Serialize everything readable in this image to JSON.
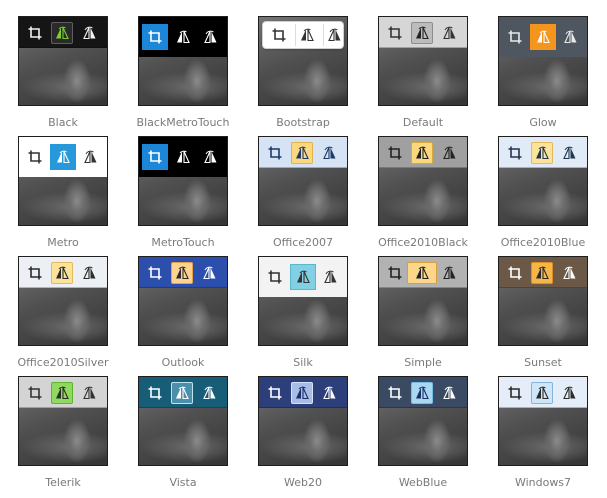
{
  "skins": [
    {
      "label": "Black",
      "tb_bg": "#151515",
      "icon": "#f2f2f2",
      "active_bg": "#2a2a2a",
      "active_border": "#5e5e5e",
      "active_icon": "#7ccf2e",
      "style": "normal"
    },
    {
      "label": "BlackMetroTouch",
      "tb_bg": "#000000",
      "icon": "#ffffff",
      "active_bg": "#1c86d8",
      "active_border": "#1c86d8",
      "active_icon": "#ffffff",
      "style": "tall-first"
    },
    {
      "label": "Bootstrap",
      "tb_bg": "#ffffff",
      "icon": "#333333",
      "active_bg": "#ffffff",
      "active_border": "#cccccc",
      "active_icon": "#333333",
      "style": "frame"
    },
    {
      "label": "Default",
      "tb_bg": "#d6d6d6",
      "icon": "#333333",
      "active_bg": "#bcbcbc",
      "active_border": "#8e8e8e",
      "active_icon": "#222222",
      "style": "normal"
    },
    {
      "label": "Glow",
      "tb_bg": "#4e5660",
      "icon": "#e8e8e8",
      "active_bg": "#f4951d",
      "active_border": "#f4951d",
      "active_icon": "#ffffff",
      "style": "tall-second"
    },
    {
      "label": "Metro",
      "tb_bg": "#ffffff",
      "icon": "#333333",
      "active_bg": "#2799db",
      "active_border": "#2799db",
      "active_icon": "#ffffff",
      "style": "tall-second"
    },
    {
      "label": "MetroTouch",
      "tb_bg": "#000000",
      "icon": "#ffffff",
      "active_bg": "#1c86d8",
      "active_border": "#1c86d8",
      "active_icon": "#ffffff",
      "style": "tall-first"
    },
    {
      "label": "Office2007",
      "tb_bg": "#d5e3f4",
      "icon": "#1f3a68",
      "active_bg": "#fbd77d",
      "active_border": "#e0b44a",
      "active_icon": "#1f3a68",
      "style": "normal"
    },
    {
      "label": "Office2010Black",
      "tb_bg": "#a0a0a0",
      "icon": "#222222",
      "active_bg": "#fbd77d",
      "active_border": "#d7a93e",
      "active_icon": "#222222",
      "style": "normal"
    },
    {
      "label": "Office2010Blue",
      "tb_bg": "#e0ebf7",
      "icon": "#22364f",
      "active_bg": "#fbe39a",
      "active_border": "#e2bb5a",
      "active_icon": "#22364f",
      "style": "normal"
    },
    {
      "label": "Office2010Silver",
      "tb_bg": "#eceff3",
      "icon": "#2b2b2b",
      "active_bg": "#fbe39a",
      "active_border": "#e2bb5a",
      "active_icon": "#2b2b2b",
      "style": "normal"
    },
    {
      "label": "Outlook",
      "tb_bg": "#2c4fae",
      "icon": "#ffffff",
      "active_bg": "#ffd38f",
      "active_border": "#e2a24c",
      "active_icon": "#2b2b2b",
      "style": "normal"
    },
    {
      "label": "Silk",
      "tb_bg": "#f3f3f3",
      "icon": "#333333",
      "active_bg": "#83d0e4",
      "active_border": "#5bb6d0",
      "active_icon": "#333333",
      "style": "tall-second"
    },
    {
      "label": "Simple",
      "tb_bg": "#b2b2b2",
      "icon": "#222222",
      "active_bg": "#fcd78a",
      "active_border": "#d79f3d",
      "active_icon": "#222222",
      "style": "normal-wide"
    },
    {
      "label": "Sunset",
      "tb_bg": "#6b5846",
      "icon": "#ffffff",
      "active_bg": "#f6b647",
      "active_border": "#dc8f1e",
      "active_icon": "#2b2b2b",
      "style": "normal"
    },
    {
      "label": "Telerik",
      "tb_bg": "#d4d4d4",
      "icon": "#333333",
      "active_bg": "#8fda5e",
      "active_border": "#5fb32e",
      "active_icon": "#2b2b2b",
      "style": "normal"
    },
    {
      "label": "Vista",
      "tb_bg": "#185d78",
      "icon": "#ffffff",
      "active_bg": "#4c8fab",
      "active_border": "#bfe3f1",
      "active_icon": "#ffffff",
      "style": "normal"
    },
    {
      "label": "Web20",
      "tb_bg": "#2d3f7b",
      "icon": "#ffffff",
      "active_bg": "#a8bce5",
      "active_border": "#d7e2f6",
      "active_icon": "#1c2f66",
      "style": "normal"
    },
    {
      "label": "WebBlue",
      "tb_bg": "#394a62",
      "icon": "#ffffff",
      "active_bg": "#a7d7f1",
      "active_border": "#78bde2",
      "active_icon": "#1c2f66",
      "style": "normal"
    },
    {
      "label": "Windows7",
      "tb_bg": "#e5eef8",
      "icon": "#2b2b2b",
      "active_bg": "#cfe6f8",
      "active_border": "#84b3dc",
      "active_icon": "#2b2b2b",
      "style": "normal"
    }
  ]
}
